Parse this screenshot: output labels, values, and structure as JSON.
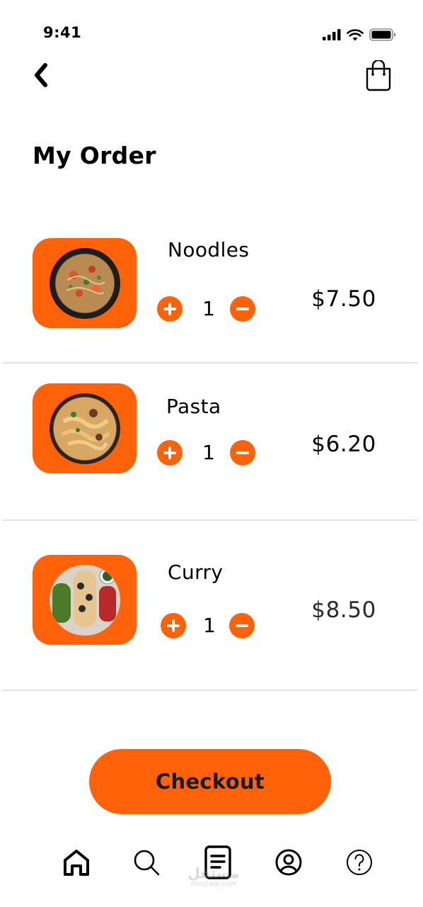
{
  "status_bar": {
    "time": "9:41"
  },
  "header": {
    "back_icon": "chevron-left-icon",
    "bag_icon": "shopping-bag-icon"
  },
  "page": {
    "title": "My Order"
  },
  "colors": {
    "accent": "#FF6209",
    "text": "#000000",
    "divider": "#E2E2E2"
  },
  "order_items": [
    {
      "name": "Noodles",
      "quantity": "1",
      "price": "$7.50"
    },
    {
      "name": "Pasta",
      "quantity": "1",
      "price": "$6.20"
    },
    {
      "name": "Curry",
      "quantity": "1",
      "price": "$8.50"
    }
  ],
  "checkout": {
    "label": "Checkout"
  },
  "tabbar": {
    "items": [
      {
        "icon": "home-icon"
      },
      {
        "icon": "search-icon"
      },
      {
        "icon": "orders-document-icon"
      },
      {
        "icon": "profile-icon"
      },
      {
        "icon": "help-icon"
      }
    ]
  },
  "watermark": {
    "logo_text": "مستقل",
    "text": "mostaql.com"
  }
}
